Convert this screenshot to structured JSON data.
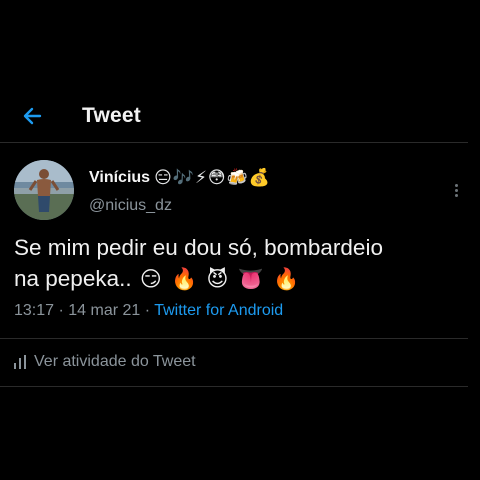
{
  "header": {
    "title": "Tweet"
  },
  "tweet": {
    "author": {
      "name": "Vinícius",
      "name_emojis": [
        "😑",
        "🎶",
        "⚡",
        "😳",
        "🍻",
        "💰"
      ],
      "handle": "@nicius_dz"
    },
    "text_line1": "Se mim pedir eu dou só, bombardeio",
    "text_line2": "na pepeka..",
    "text_emojis": [
      "😏",
      "🔥",
      "😈",
      "👅",
      "🔥"
    ],
    "time": "13:17 · 14 mar 21 · ",
    "source": "Twitter for Android"
  },
  "activity": {
    "label": "Ver atividade do Tweet"
  },
  "colors": {
    "link": "#1d9bf0",
    "secondary_text": "#8b949b",
    "background": "#000000"
  },
  "icons": [
    "back-arrow-icon",
    "more-options-icon",
    "analytics-icon"
  ]
}
